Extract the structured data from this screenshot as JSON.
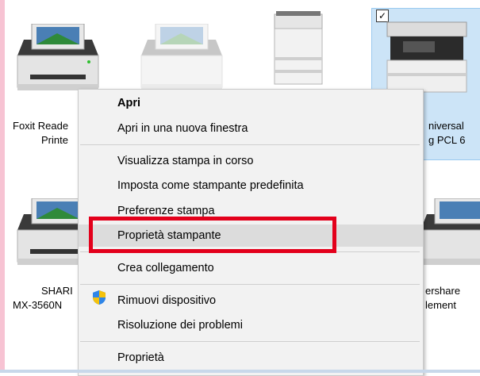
{
  "printers": [
    {
      "label_line1": "Foxit Reade",
      "label_line2": "Printe"
    },
    {
      "label_line1": "",
      "label_line2": ""
    },
    {
      "label_line1": "",
      "label_line2": ""
    },
    {
      "label_line1": "niversal",
      "label_line2": "g PCL 6"
    },
    {
      "label_line1": "SHARI",
      "label_line2": "MX-3560N"
    },
    {
      "label_line1": "ershare",
      "label_line2": "lement"
    }
  ],
  "context_menu": {
    "items": [
      {
        "label": "Apri",
        "bold": true
      },
      {
        "label": "Apri in una nuova finestra"
      },
      {
        "label": "Visualizza stampa in corso"
      },
      {
        "label": "Imposta come stampante predefinita"
      },
      {
        "label": "Preferenze stampa"
      },
      {
        "label": "Proprietà stampante",
        "hovered": true
      },
      {
        "label": "Crea collegamento"
      },
      {
        "label": "Rimuovi dispositivo",
        "icon": "uac-shield-icon"
      },
      {
        "label": "Risoluzione dei problemi"
      },
      {
        "label": "Proprietà"
      }
    ]
  },
  "colors": {
    "highlight": "#e3001b",
    "selection": "#cce4f7",
    "menu_bg": "#f2f2f2"
  }
}
